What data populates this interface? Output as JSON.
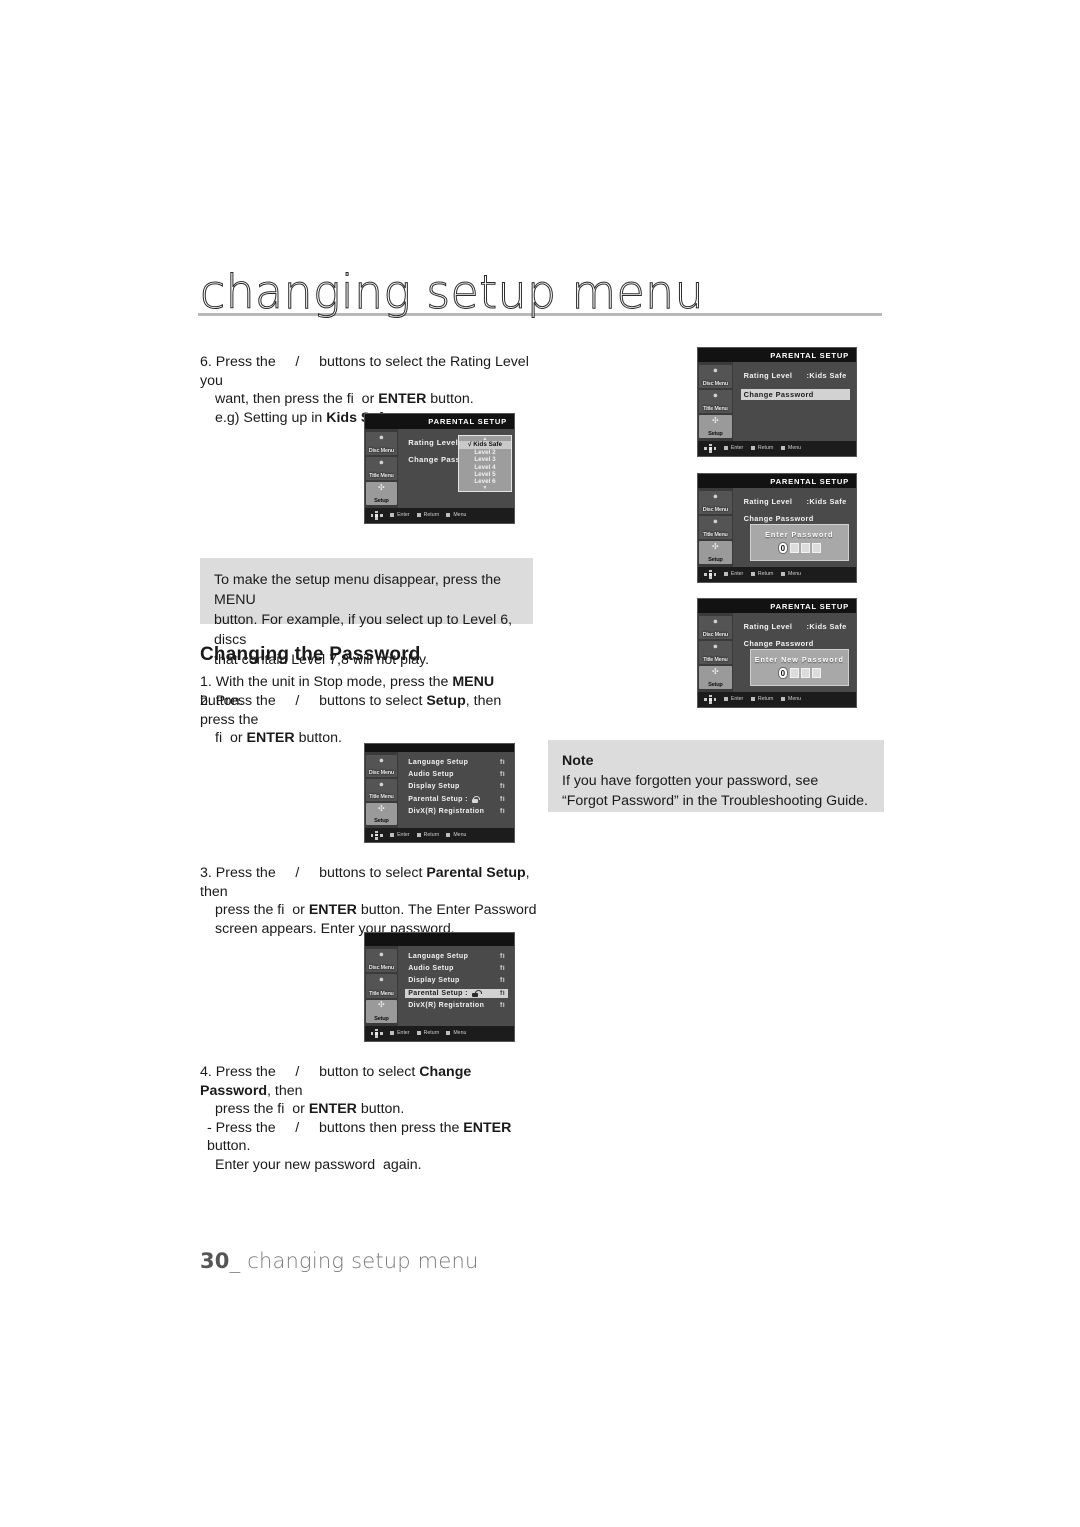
{
  "page": {
    "header_title": "changing setup menu",
    "footer_page_number": "30",
    "footer_text": "changing setup menu"
  },
  "steps": {
    "step6": {
      "line1": "6. Press the     /     buttons to select the Rating Level you",
      "line2_a": "want, then press the fi  or ",
      "line2_b": "ENTER",
      "line2_c": " button.",
      "line3_a": "e.g) Setting up in ",
      "line3_b": "Kids Safe",
      "line3_c": "."
    },
    "note_menu": {
      "line1": "To make the setup menu disappear, press the MENU",
      "line2": "button. For example, if you select up to Level 6, discs",
      "line3": "that contain Level 7,8 will not play."
    },
    "section_heading": "Changing the Password",
    "step1": {
      "line1_a": "1. With the unit in Stop mode, press the ",
      "line1_b": "MENU",
      "line1_c": " button."
    },
    "step2": {
      "line1_a": "2. Press the     /     buttons to select ",
      "line1_b": "Setup",
      "line1_c": ", then press the",
      "line2_a": "fi  or ",
      "line2_b": "ENTER",
      "line2_c": " button."
    },
    "step3": {
      "line1_a": "3. Press the     /     buttons to select ",
      "line1_b": "Parental Setup",
      "line1_c": ", then",
      "line2_a": "press the fi  or ",
      "line2_b": "ENTER",
      "line2_c": " button. The Enter Password",
      "line3": "screen appears. Enter your password."
    },
    "step4": {
      "line1_a": "4. Press the     /     button to select ",
      "line1_b": "Change Password",
      "line1_c": ", then",
      "line2_a": "press the fi  or ",
      "line2_b": "ENTER",
      "line2_c": " button.",
      "line3_a": "- Press the     /     buttons then press the ",
      "line3_b": "ENTER",
      "line3_c": " button.",
      "line4": "Enter your new password  again."
    },
    "note_forgot": {
      "title": "Note",
      "line1": "If you have forgotten your password, see",
      "line2": "“Forgot Password” in the Troubleshooting Guide."
    }
  },
  "osd": {
    "sidebar": [
      {
        "label": "Disc Menu",
        "icon": "disc-menu-icon",
        "active": false
      },
      {
        "label": "Title Menu",
        "icon": "title-menu-icon",
        "active": false
      },
      {
        "label": "Setup",
        "icon": "setup-gear-icon",
        "active": true
      }
    ],
    "legend": [
      {
        "label": "Enter",
        "icon": "enter-chip-icon"
      },
      {
        "label": "Return",
        "icon": "return-chip-icon"
      },
      {
        "label": "Menu",
        "icon": "menu-chip-icon"
      }
    ],
    "parental_title": "PARENTAL SETUP",
    "rating_level_label": "Rating Level",
    "change_password_label": "Change Password",
    "rating_value": ":Kids Safe",
    "rating_options": [
      "Kids Safe",
      "Level 2",
      "Level 3",
      "Level 4",
      "Level 5",
      "Level 6"
    ],
    "rating_selected": "Kids Safe",
    "rating_check_mark": "√",
    "scroll_up": "▲",
    "scroll_down": "▼",
    "enter_password_title": "Enter Password",
    "enter_new_password_title": "Enter New Password",
    "password_first_digit": "0",
    "setup_menu_items": [
      {
        "label": "Language Setup",
        "value": "fi",
        "icon": null,
        "selected": false
      },
      {
        "label": "Audio Setup",
        "value": "fi",
        "icon": null,
        "selected": false
      },
      {
        "label": "Display Setup",
        "value": "fi",
        "icon": null,
        "selected": false
      },
      {
        "label": "Parental Setup :",
        "value": "fi",
        "icon": "padlock-icon",
        "selected": false
      },
      {
        "label": "DivX(R) Registration",
        "value": "fi",
        "icon": null,
        "selected": false
      }
    ],
    "setup_menu_selected_index": 3
  },
  "colors": {
    "gray_box": "#dcdcdc",
    "osd_dark": "#2e2e2e",
    "osd_body": "#4a4a4a",
    "osd_header": "#121212",
    "highlight": "#d2d2d2",
    "rule": "#b8b8b8"
  }
}
